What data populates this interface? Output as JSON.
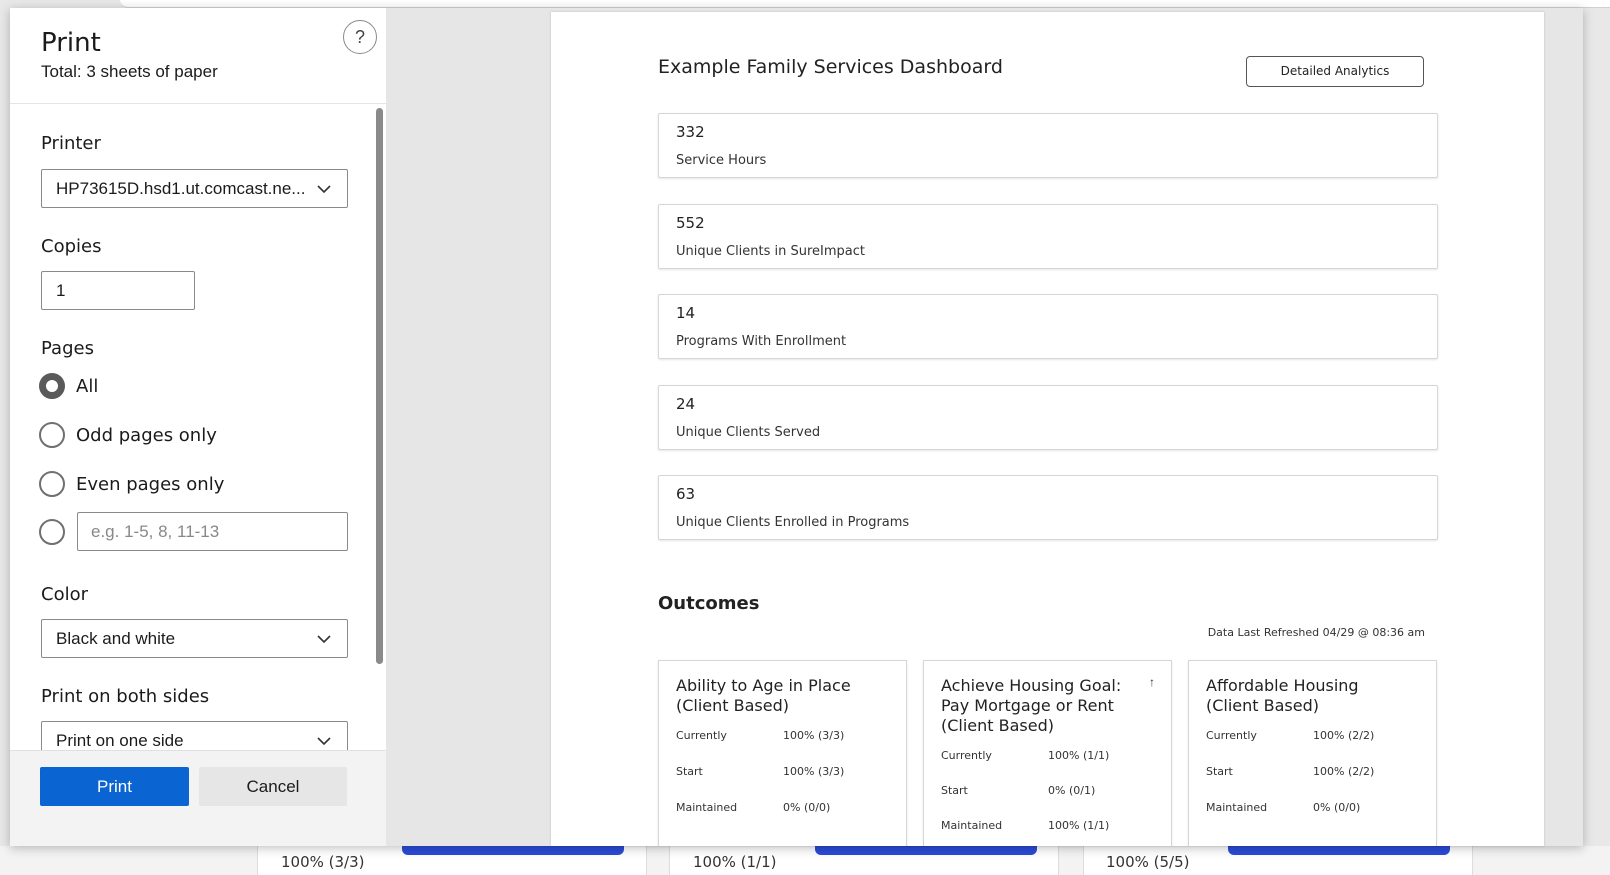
{
  "print_panel": {
    "title": "Print",
    "total": "Total: 3 sheets of paper",
    "help": "?",
    "printer": {
      "label": "Printer",
      "value": "HP73615D.hsd1.ut.comcast.ne..."
    },
    "copies": {
      "label": "Copies",
      "value": "1"
    },
    "pages": {
      "label": "Pages",
      "options": [
        "All",
        "Odd pages only",
        "Even pages only"
      ],
      "selected": "All",
      "custom_placeholder": "e.g. 1-5, 8, 11-13"
    },
    "color": {
      "label": "Color",
      "value": "Black and white"
    },
    "duplex": {
      "label": "Print on both sides",
      "value": "Print on one side"
    },
    "print_button": "Print",
    "cancel_button": "Cancel"
  },
  "preview": {
    "dashboard_title": "Example Family Services Dashboard",
    "analytics_button": "Detailed Analytics",
    "stats": [
      {
        "value": "332",
        "label": "Service Hours"
      },
      {
        "value": "552",
        "label": "Unique Clients in SureImpact"
      },
      {
        "value": "14",
        "label": "Programs With Enrollment"
      },
      {
        "value": "24",
        "label": "Unique Clients Served"
      },
      {
        "value": "63",
        "label": "Unique Clients Enrolled in Programs"
      }
    ],
    "outcomes_title": "Outcomes",
    "refreshed": "Data Last Refreshed 04/29 @ 08:36 am",
    "outcome_cards": [
      {
        "title": "Ability to Age in Place (Client Based)",
        "currently": "100% (3/3)",
        "start": "100% (3/3)",
        "maintained": "0% (0/0)"
      },
      {
        "title": "Achieve Housing Goal: Pay Mortgage or Rent (Client Based)",
        "currently": "100% (1/1)",
        "start": "0% (0/1)",
        "maintained": "100% (1/1)",
        "arrow": "↑"
      },
      {
        "title": "Affordable Housing (Client Based)",
        "currently": "100% (2/2)",
        "start": "100% (2/2)",
        "maintained": "0% (0/0)"
      }
    ],
    "row_labels": {
      "currently": "Currently",
      "start": "Start",
      "maintained": "Maintained"
    }
  },
  "background": {
    "card_values": [
      "100% (3/3)",
      "100% (1/1)",
      "100% (5/5)"
    ],
    "accent": "#2b4bd8"
  }
}
